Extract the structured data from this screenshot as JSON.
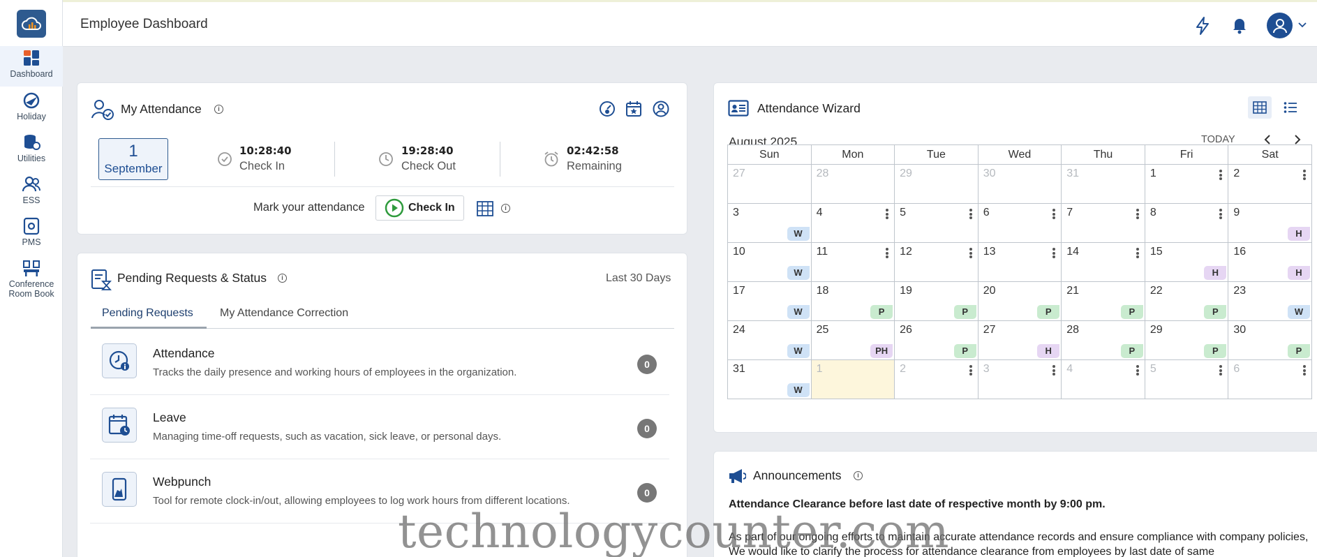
{
  "header": {
    "title": "Employee Dashboard"
  },
  "sidebar": {
    "items": [
      {
        "label": "Dashboard",
        "icon": "dashboard-icon"
      },
      {
        "label": "Holiday",
        "icon": "holiday-icon"
      },
      {
        "label": "Utilities",
        "icon": "utilities-icon"
      },
      {
        "label": "ESS",
        "icon": "users-icon"
      },
      {
        "label": "PMS",
        "icon": "pms-icon"
      },
      {
        "label": "Conference Room Book",
        "icon": "conference-icon"
      }
    ]
  },
  "attendance": {
    "title": "My Attendance",
    "day": "1",
    "month": "September",
    "check_in_time": "10:28:40",
    "check_in_label": "Check In",
    "check_out_time": "19:28:40",
    "check_out_label": "Check Out",
    "remaining_time": "02:42:58",
    "remaining_label": "Remaining",
    "mark_label": "Mark your attendance",
    "check_in_button": "Check In"
  },
  "pending": {
    "title": "Pending Requests & Status",
    "period": "Last 30 Days",
    "tabs": [
      "Pending Requests",
      "My Attendance Correction"
    ],
    "rows": [
      {
        "name": "Attendance",
        "desc": "Tracks the daily presence and working hours of employees in the organization.",
        "count": "0"
      },
      {
        "name": "Leave",
        "desc": "Managing time-off requests, such as vacation, sick leave, or personal days.",
        "count": "0"
      },
      {
        "name": "Webpunch",
        "desc": "Tool for remote clock-in/out, allowing employees to log work hours from different locations.",
        "count": "0"
      }
    ]
  },
  "wizard": {
    "title": "Attendance Wizard",
    "month": "August 2025",
    "today_label": "TODAY",
    "days": [
      "Sun",
      "Mon",
      "Tue",
      "Wed",
      "Thu",
      "Fri",
      "Sat"
    ],
    "weeks": [
      [
        {
          "d": "27",
          "o": true
        },
        {
          "d": "28",
          "o": true
        },
        {
          "d": "29",
          "o": true
        },
        {
          "d": "30",
          "o": true
        },
        {
          "d": "31",
          "o": true
        },
        {
          "d": "1",
          "k": true
        },
        {
          "d": "2",
          "k": true
        }
      ],
      [
        {
          "d": "3",
          "b": "W"
        },
        {
          "d": "4",
          "k": true
        },
        {
          "d": "5",
          "k": true
        },
        {
          "d": "6",
          "k": true
        },
        {
          "d": "7",
          "k": true
        },
        {
          "d": "8",
          "k": true
        },
        {
          "d": "9",
          "b": "H"
        }
      ],
      [
        {
          "d": "10",
          "b": "W"
        },
        {
          "d": "11",
          "k": true
        },
        {
          "d": "12",
          "k": true
        },
        {
          "d": "13",
          "k": true
        },
        {
          "d": "14",
          "k": true
        },
        {
          "d": "15",
          "b": "H"
        },
        {
          "d": "16",
          "b": "H"
        }
      ],
      [
        {
          "d": "17",
          "b": "W"
        },
        {
          "d": "18",
          "b": "P"
        },
        {
          "d": "19",
          "b": "P"
        },
        {
          "d": "20",
          "b": "P"
        },
        {
          "d": "21",
          "b": "P"
        },
        {
          "d": "22",
          "b": "P"
        },
        {
          "d": "23",
          "b": "W"
        }
      ],
      [
        {
          "d": "24",
          "b": "W"
        },
        {
          "d": "25",
          "b": "PH"
        },
        {
          "d": "26",
          "b": "P"
        },
        {
          "d": "27",
          "b": "H"
        },
        {
          "d": "28",
          "b": "P"
        },
        {
          "d": "29",
          "b": "P"
        },
        {
          "d": "30",
          "b": "P"
        }
      ],
      [
        {
          "d": "31",
          "b": "W"
        },
        {
          "d": "1",
          "o": true,
          "t": true
        },
        {
          "d": "2",
          "o": true,
          "k": true
        },
        {
          "d": "3",
          "o": true,
          "k": true
        },
        {
          "d": "4",
          "o": true,
          "k": true
        },
        {
          "d": "5",
          "o": true,
          "k": true
        },
        {
          "d": "6",
          "o": true,
          "k": true
        }
      ]
    ]
  },
  "announcements": {
    "title": "Announcements",
    "headline": "Attendance Clearance before last date of respective month by 9:00 pm.",
    "body": "As part of our ongoing efforts to maintain accurate attendance records and ensure compliance with company policies, We would like to clarify the process for attendance clearance from employees by last date of same"
  },
  "watermark": "technologycounter.com",
  "colors": {
    "primary": "#1e4e93",
    "weekend": "#cfe2f6",
    "holiday": "#e6d6f3",
    "present": "#c9ebcf",
    "today": "#fdf6dc"
  }
}
